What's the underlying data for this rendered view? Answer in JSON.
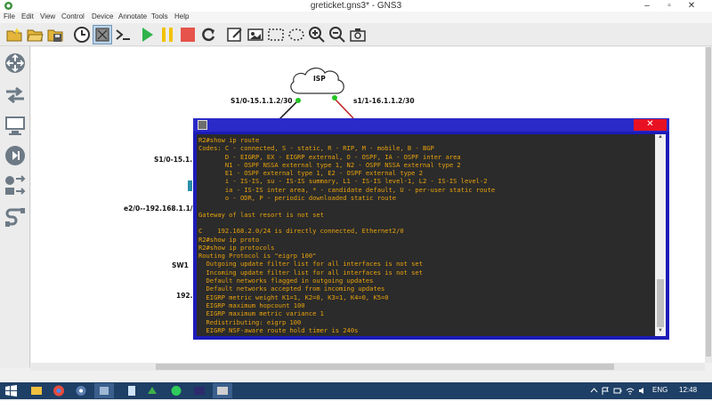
{
  "window": {
    "title": "greticket.gns3* - GNS3",
    "minimize": "–",
    "maximize": "▫",
    "close": "✕"
  },
  "menu": [
    "File",
    "Edit",
    "View",
    "Control",
    "Device",
    "Annotate",
    "Tools",
    "Help"
  ],
  "toolbar": [
    "new-project",
    "open-project",
    "save-project",
    "snapshot",
    "show-interface-labels",
    "console-all",
    "start-all",
    "suspend-all",
    "stop-all",
    "reload-all",
    "add-note",
    "insert-picture",
    "draw-rectangle",
    "draw-ellipse",
    "zoom-in",
    "zoom-out",
    "screenshot"
  ],
  "dock": [
    "routers",
    "switches",
    "end-devices",
    "security-devices",
    "all-devices",
    "add-link"
  ],
  "canvas": {
    "cloud_label": "ISP",
    "labels": {
      "isp_left": "S1/0-15.1.1.2/30",
      "isp_right": "s1/1-16.1.1.2/30",
      "r_left": "S1/0-15.1.",
      "e2": "e2/0--192.168.1.1/2",
      "sw1": "SW1",
      "net": "192.1"
    }
  },
  "console": {
    "close": "✕",
    "lines": [
      "R2#show ip route",
      "Codes: C - connected, S - static, R - RIP, M - mobile, B - BGP",
      "       D - EIGRP, EX - EIGRP external, O - OSPF, IA - OSPF inter area",
      "       N1 - OSPF NSSA external type 1, N2 - OSPF NSSA external type 2",
      "       E1 - OSPF external type 1, E2 - OSPF external type 2",
      "       i - IS-IS, su - IS-IS summary, L1 - IS-IS level-1, L2 - IS-IS level-2",
      "       ia - IS-IS inter area, * - candidate default, U - per-user static route",
      "       o - ODR, P - periodic downloaded static route",
      "",
      "Gateway of last resort is not set",
      "",
      "C    192.168.2.0/24 is directly connected, Ethernet2/0",
      "R2#show ip proto",
      "R2#show ip protocols",
      "Routing Protocol is \"eigrp 100\"",
      "  Outgoing update filter list for all interfaces is not set",
      "  Incoming update filter list for all interfaces is not set",
      "  Default networks flagged in outgoing updates",
      "  Default networks accepted from incoming updates",
      "  EIGRP metric weight K1=1, K2=0, K3=1, K4=0, K5=0",
      "  EIGRP maximum hopcount 100",
      "  EIGRP maximum metric variance 1",
      "  Redistributing: eigrp 100",
      "  EIGRP NSF-aware route hold timer is 240s"
    ]
  },
  "taskbar": {
    "apps": [
      "file-explorer",
      "chrome",
      "unknown-app",
      "gns3",
      "notepad",
      "network-app",
      "whatsapp",
      "terminal",
      "gns3-console"
    ],
    "language": "ENG",
    "time": "12:48"
  },
  "colors": {
    "terminal_text": "#e8a20c",
    "terminal_bg": "#2b2b2b",
    "console_frame": "#1c1cb8",
    "taskbar": "#1e3f66"
  }
}
